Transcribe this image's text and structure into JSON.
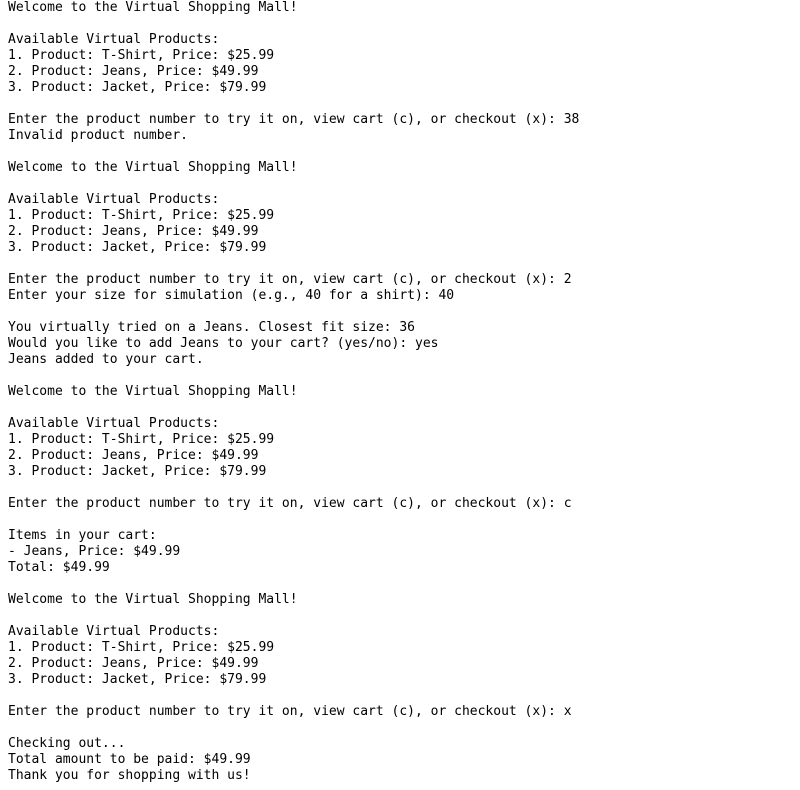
{
  "terminal": {
    "lines": [
      "Welcome to the Virtual Shopping Mall!",
      "",
      "Available Virtual Products:",
      "1. Product: T-Shirt, Price: $25.99",
      "2. Product: Jeans, Price: $49.99",
      "3. Product: Jacket, Price: $79.99",
      "",
      "Enter the product number to try it on, view cart (c), or checkout (x): 38",
      "Invalid product number.",
      "",
      "Welcome to the Virtual Shopping Mall!",
      "",
      "Available Virtual Products:",
      "1. Product: T-Shirt, Price: $25.99",
      "2. Product: Jeans, Price: $49.99",
      "3. Product: Jacket, Price: $79.99",
      "",
      "Enter the product number to try it on, view cart (c), or checkout (x): 2",
      "Enter your size for simulation (e.g., 40 for a shirt): 40",
      "",
      "You virtually tried on a Jeans. Closest fit size: 36",
      "Would you like to add Jeans to your cart? (yes/no): yes",
      "Jeans added to your cart.",
      "",
      "Welcome to the Virtual Shopping Mall!",
      "",
      "Available Virtual Products:",
      "1. Product: T-Shirt, Price: $25.99",
      "2. Product: Jeans, Price: $49.99",
      "3. Product: Jacket, Price: $79.99",
      "",
      "Enter the product number to try it on, view cart (c), or checkout (x): c",
      "",
      "Items in your cart:",
      "- Jeans, Price: $49.99",
      "Total: $49.99",
      "",
      "Welcome to the Virtual Shopping Mall!",
      "",
      "Available Virtual Products:",
      "1. Product: T-Shirt, Price: $25.99",
      "2. Product: Jeans, Price: $49.99",
      "3. Product: Jacket, Price: $79.99",
      "",
      "Enter the product number to try it on, view cart (c), or checkout (x): x",
      "",
      "Checking out...",
      "Total amount to be paid: $49.99",
      "Thank you for shopping with us!"
    ]
  }
}
